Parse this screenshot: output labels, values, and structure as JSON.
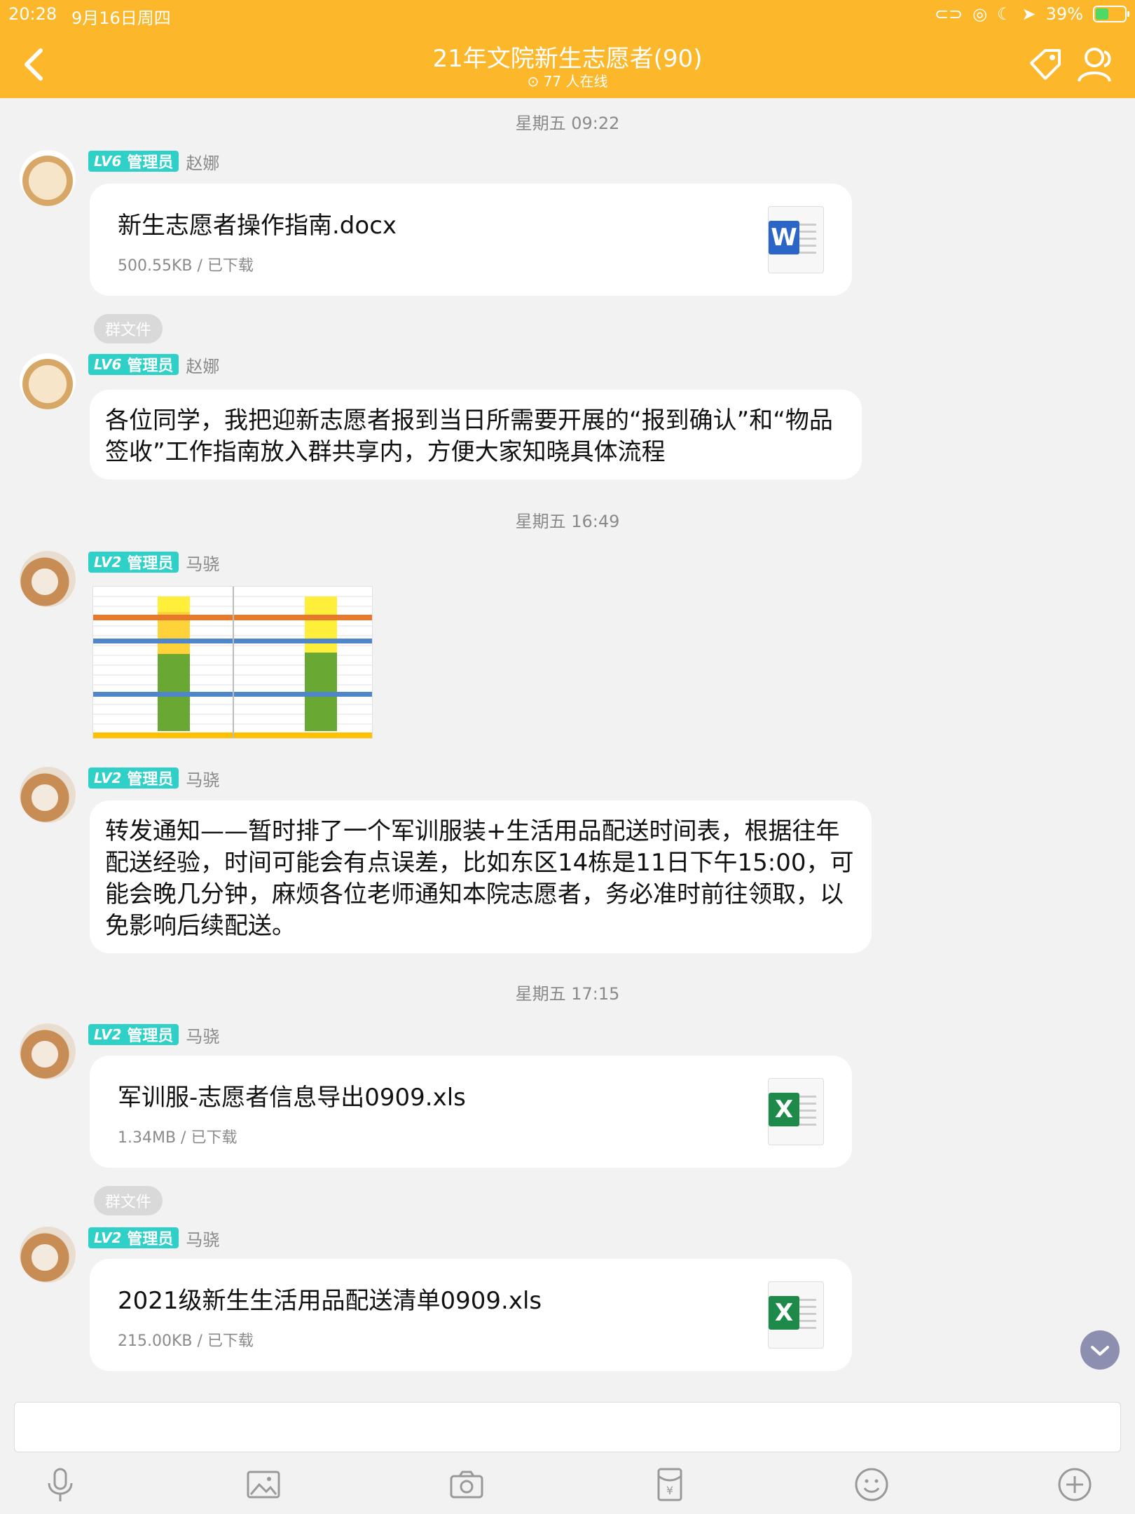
{
  "status_bar": {
    "time": "20:28",
    "date": "9月16日周四",
    "battery": "39%"
  },
  "header": {
    "title": "21年文院新生志愿者(90)",
    "online": "77 人在线"
  },
  "messages": {
    "ts1": "星期五 09:22",
    "m1": {
      "level": "LV6",
      "role": "管理员",
      "sender": "赵娜",
      "file_name": "新生志愿者操作指南.docx",
      "file_info": "500.55KB / 已下载",
      "icon": "word-icon"
    },
    "chip1": "群文件",
    "m2": {
      "level": "LV6",
      "role": "管理员",
      "sender": "赵娜",
      "text": "各位同学，我把迎新志愿者报到当日所需要开展的“报到确认”和“物品签收”工作指南放入群共享内，方便大家知晓具体流程"
    },
    "ts2": "星期五 16:49",
    "m3": {
      "level": "LV2",
      "role": "管理员",
      "sender": "马骁"
    },
    "m4": {
      "level": "LV2",
      "role": "管理员",
      "sender": "马骁",
      "text": "转发通知——暂时排了一个军训服装+生活用品配送时间表，根据往年配送经验，时间可能会有点误差，比如东区14栋是11日下午15:00，可能会晚几分钟，麻烦各位老师通知本院志愿者，务必准时前往领取，以免影响后续配送。"
    },
    "ts3": "星期五 17:15",
    "m5": {
      "level": "LV2",
      "role": "管理员",
      "sender": "马骁",
      "file_name": "军训服-志愿者信息导出0909.xls",
      "file_info": "1.34MB / 已下载",
      "icon": "excel-icon"
    },
    "chip2": "群文件",
    "m6": {
      "level": "LV2",
      "role": "管理员",
      "sender": "马骁",
      "file_name": "2021级新生生活用品配送清单0909.xls",
      "file_info": "215.00KB / 已下载",
      "icon": "excel-icon"
    }
  },
  "file_icon_letters": {
    "word": "W",
    "excel": "X"
  },
  "colors": {
    "header": "#fdb72b",
    "badge": "#2ed0c7",
    "word": "#2b65c8",
    "excel": "#1e8a4a"
  },
  "toolbar": [
    "microphone-icon",
    "image-icon",
    "camera-icon",
    "red-packet-icon",
    "emoji-icon",
    "plus-icon"
  ]
}
